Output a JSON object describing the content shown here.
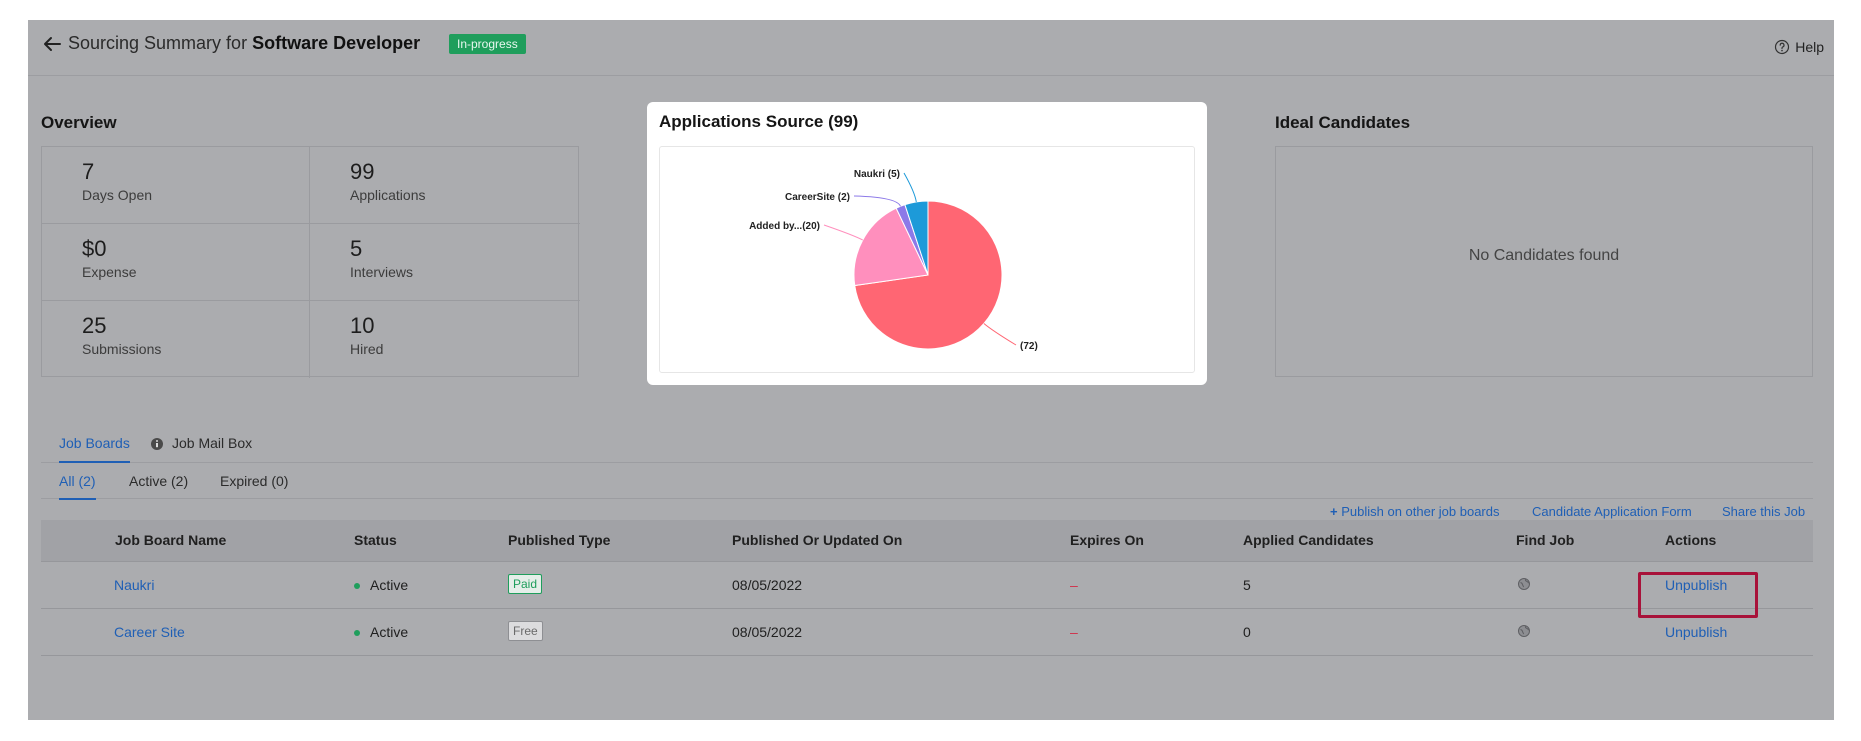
{
  "header": {
    "title_prefix": "Sourcing Summary for",
    "job_title": "Software Developer",
    "status": "In-progress",
    "help_label": "Help"
  },
  "overview": {
    "title": "Overview",
    "stats": [
      {
        "value": "7",
        "label": "Days Open"
      },
      {
        "value": "99",
        "label": "Applications"
      },
      {
        "value": "$0",
        "label": "Expense"
      },
      {
        "value": "5",
        "label": "Interviews"
      },
      {
        "value": "25",
        "label": "Submissions"
      },
      {
        "value": "10",
        "label": "Hired"
      }
    ]
  },
  "applications_source": {
    "title": "Applications Source (99)"
  },
  "chart_data": {
    "type": "pie",
    "title": "Applications Source (99)",
    "categories": [
      "",
      "Added by...",
      "CareerSite",
      "Naukri"
    ],
    "values": [
      72,
      20,
      2,
      5
    ],
    "labels": [
      "(72)",
      "Added by...(20)",
      "CareerSite (2)",
      "Naukri (5)"
    ],
    "colors": [
      "#ff6673",
      "#ff8fbd",
      "#8c79e8",
      "#1d9ad9"
    ]
  },
  "ideal_candidates": {
    "title": "Ideal Candidates",
    "empty_message": "No Candidates found"
  },
  "tabs": {
    "job_boards": "Job Boards",
    "job_mail_box": "Job Mail Box"
  },
  "subtabs": {
    "all": "All (2)",
    "active": "Active (2)",
    "expired": "Expired (0)"
  },
  "links": {
    "publish": "Publish on other job boards",
    "candidate_form": "Candidate Application Form",
    "share": "Share this Job"
  },
  "table": {
    "columns": [
      "Job Board Name",
      "Status",
      "Published Type",
      "Published Or Updated On",
      "Expires On",
      "Applied Candidates",
      "Find Job",
      "Actions"
    ],
    "rows": [
      {
        "name": "Naukri",
        "status": "Active",
        "type": "Paid",
        "published_on": "08/05/2022",
        "expires_on": "–",
        "applied": "5",
        "action": "Unpublish"
      },
      {
        "name": "Career Site",
        "status": "Active",
        "type": "Free",
        "published_on": "08/05/2022",
        "expires_on": "–",
        "applied": "0",
        "action": "Unpublish"
      }
    ]
  }
}
